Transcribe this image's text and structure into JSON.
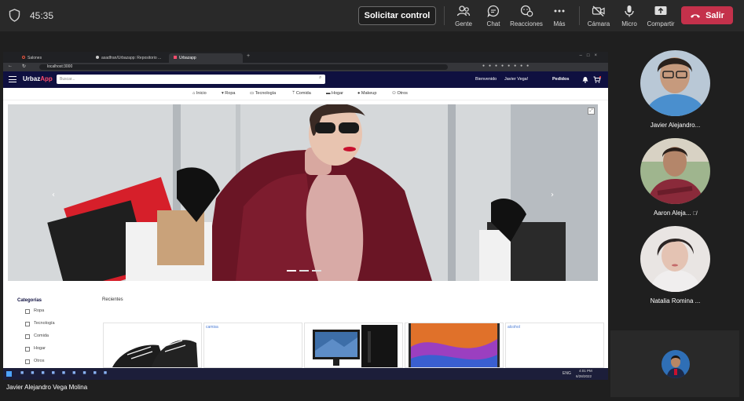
{
  "meeting": {
    "timer": "45:35",
    "request_control": "Solicitar control",
    "tools": [
      {
        "label": "Gente",
        "icon": "people-icon"
      },
      {
        "label": "Chat",
        "icon": "chat-icon"
      },
      {
        "label": "Reacciones",
        "icon": "reactions-icon"
      },
      {
        "label": "Más",
        "icon": "more-icon"
      },
      {
        "label": "Cámara",
        "icon": "camera-off-icon"
      },
      {
        "label": "Micro",
        "icon": "microphone-icon"
      },
      {
        "label": "Compartir",
        "icon": "share-icon"
      }
    ],
    "leave_label": "Salir",
    "colors": {
      "leave": "#c4314b",
      "bar": "#292929",
      "stage": "#1f1f1f"
    }
  },
  "participants": [
    {
      "name": "Javier Alejandro..."
    },
    {
      "name": "Aaron Aleja..."
    },
    {
      "name": "Natalia Romina ..."
    }
  ],
  "presenter_label": "Javier Alejandro Vega Molina",
  "shared": {
    "tabs": [
      "Salones",
      "asadfran/Urbazapp: Repositorio ...",
      "Urbazapp"
    ],
    "url": "localhost:3000",
    "app": {
      "logo_main": "Urbaz",
      "logo_accent": "App",
      "search_placeholder": "Buscar...",
      "welcome": "Bienvenido",
      "user": "Javier Vega!",
      "orders": "Pedidos",
      "categories_nav": [
        "Inicio",
        "Ropa",
        "Tecnología",
        "Comida",
        "Hogar",
        "Makeup",
        "Otros"
      ],
      "sidebar_title": "Categorías",
      "sidebar_items": [
        "Ropa",
        "Tecnología",
        "Comida",
        "Hogar",
        "Otros"
      ],
      "recent_title": "Recientes",
      "product_alts": [
        "camisa",
        "alcohol"
      ]
    },
    "taskbar": {
      "time": "4:01 PM",
      "date": "6/28/2022",
      "lang": "ENG"
    }
  }
}
